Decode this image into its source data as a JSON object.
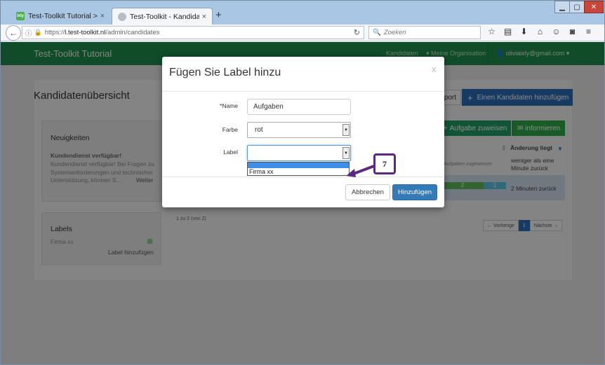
{
  "browser": {
    "tabs": [
      {
        "label": "Test-Toolkit Tutorial > Ixly",
        "favicon_text": "ixly"
      },
      {
        "label": "Test-Toolkit - Kandidatenü..."
      }
    ],
    "url_prefix": "https://",
    "url_host": "l.test-toolkit.nl",
    "url_path": "/admin/candidates",
    "search_placeholder": "Zoeken",
    "new_tab": "+",
    "close": "×"
  },
  "app": {
    "brand": "Test-Toolkit Tutorial",
    "nav": {
      "kandidaten": "Kandidaten",
      "organisation": "Meine Organisation",
      "user": "oliviaixly@gmail.com"
    }
  },
  "page": {
    "title": "Kandidatenübersicht",
    "export_label": "port",
    "add_candidate_label": "Einen Kandidaten hinzufügen",
    "news": {
      "title": "Neuigkeiten",
      "headline": "Kundendienst verfügbar!",
      "body": "Kundendienst verfügbar! Bei Fragen zu Systemanforderungen und technischer Unterstützung, können S...",
      "more": "Weiter"
    },
    "labels_panel": {
      "title": "Labels",
      "item": "Firma xx",
      "add": "Label hinzufügen"
    },
    "assign_task_label": "Aufgabe zuweisen",
    "inform_label": "informieren",
    "col_changed": "Änderung liegt",
    "no_tasks": "ine Aufgaben zugewiesen",
    "time_1": "weniger als eine Minute zurück",
    "progress_green": "2",
    "progress_blue": "1",
    "time_2": "2 Minuten zurück",
    "pager_info": "1 zu 2 (von 2)",
    "pager_prev": "← Vorherige",
    "pager_current": "1",
    "pager_next": "Nächste →"
  },
  "modal": {
    "title": "Fügen Sie Label hinzu",
    "close": "x",
    "name_label": "Name",
    "name_value": "Aufgaben",
    "farbe_label": "Farbe",
    "farbe_value": "rot",
    "label_label": "Label",
    "label_value": "",
    "dropdown_option": "Firma xx",
    "cancel": "Abbrechen",
    "submit": "Hinzufügen"
  },
  "annotation": {
    "step": "7",
    "color": "#5b2a7e"
  }
}
